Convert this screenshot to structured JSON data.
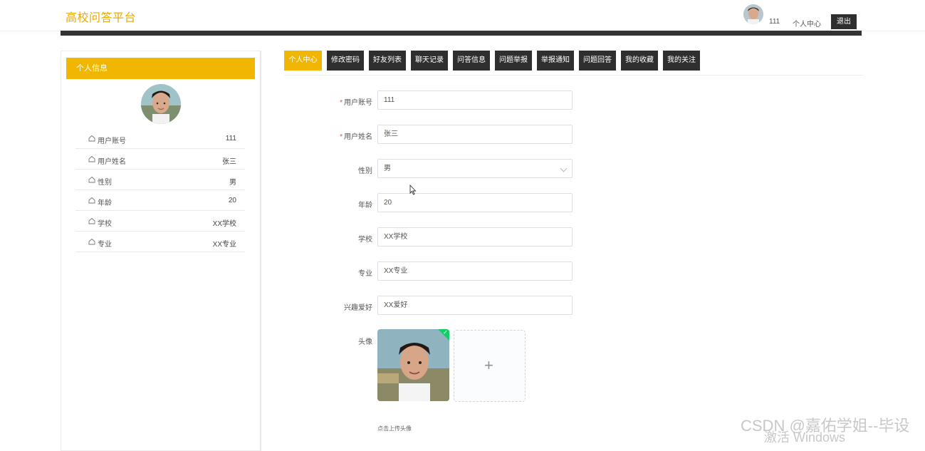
{
  "header": {
    "brand": "高校问答平台",
    "username": "111",
    "center_link": "个人中心",
    "logout": "退出"
  },
  "sidebar": {
    "title": "个人信息",
    "rows": [
      {
        "label": "用户账号",
        "value": "111"
      },
      {
        "label": "用户姓名",
        "value": "张三"
      },
      {
        "label": "性别",
        "value": "男"
      },
      {
        "label": "年龄",
        "value": "20"
      },
      {
        "label": "学校",
        "value": "XX学校"
      },
      {
        "label": "专业",
        "value": "XX专业"
      }
    ]
  },
  "tabs": [
    "个人中心",
    "修改密码",
    "好友列表",
    "聊天记录",
    "问答信息",
    "问题举报",
    "举报通知",
    "问题回答",
    "我的收藏",
    "我的关注"
  ],
  "active_tab": 0,
  "form": {
    "fields": [
      {
        "label": "用户账号",
        "value": "111",
        "required": true
      },
      {
        "label": "用户姓名",
        "value": "张三",
        "required": true
      },
      {
        "label": "性别",
        "value": "男",
        "required": false,
        "type": "select"
      },
      {
        "label": "年龄",
        "value": "20",
        "required": false
      },
      {
        "label": "学校",
        "value": "XX学校",
        "required": false
      },
      {
        "label": "专业",
        "value": "XX专业",
        "required": false
      },
      {
        "label": "兴趣爱好",
        "value": "XX爱好",
        "required": false
      }
    ],
    "avatar_label": "头像",
    "upload_hint": "点击上传头像",
    "plus": "+",
    "required_mark": "*"
  },
  "watermark": "CSDN @嘉佑学姐--毕设",
  "os_notice": "激活 Windows",
  "colors": {
    "accent": "#f1b601",
    "brand": "#e7a80a",
    "dark": "#2f2f2f"
  }
}
